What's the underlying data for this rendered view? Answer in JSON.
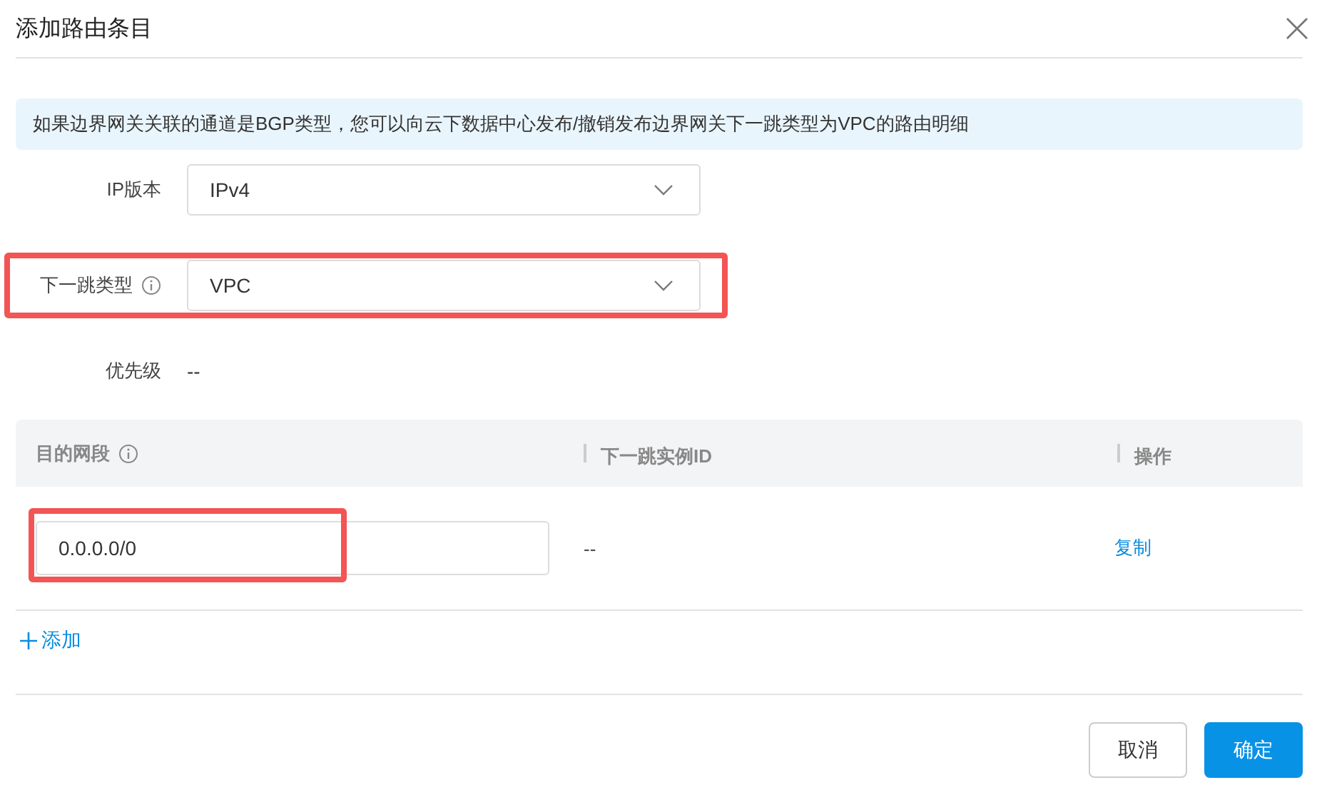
{
  "dialog": {
    "title": "添加路由条目"
  },
  "notice": "如果边界网关关联的通道是BGP类型，您可以向云下数据中心发布/撤销发布边界网关下一跳类型为VPC的路由明细",
  "fields": [
    {
      "label": "IP版本",
      "kind": "select",
      "value": "IPv4",
      "info": false,
      "highlighted": false
    },
    {
      "label": "下一跳类型",
      "kind": "select",
      "value": "VPC",
      "info": true,
      "highlighted": true
    },
    {
      "label": "优先级",
      "kind": "text",
      "value": "--",
      "info": false,
      "highlighted": false
    }
  ],
  "table": {
    "columns": [
      {
        "label": "目的网段",
        "info": true
      },
      {
        "label": "下一跳实例ID",
        "info": false
      },
      {
        "label": "操作",
        "info": false
      }
    ],
    "rows": [
      {
        "destination": "0.0.0.0/0",
        "destination_highlighted": true,
        "next_hop_instance": "--",
        "action": "复制"
      }
    ]
  },
  "add_link": {
    "label": "添加"
  },
  "buttons": [
    {
      "label": "取消",
      "kind": "secondary"
    },
    {
      "label": "确定",
      "kind": "primary"
    }
  ]
}
